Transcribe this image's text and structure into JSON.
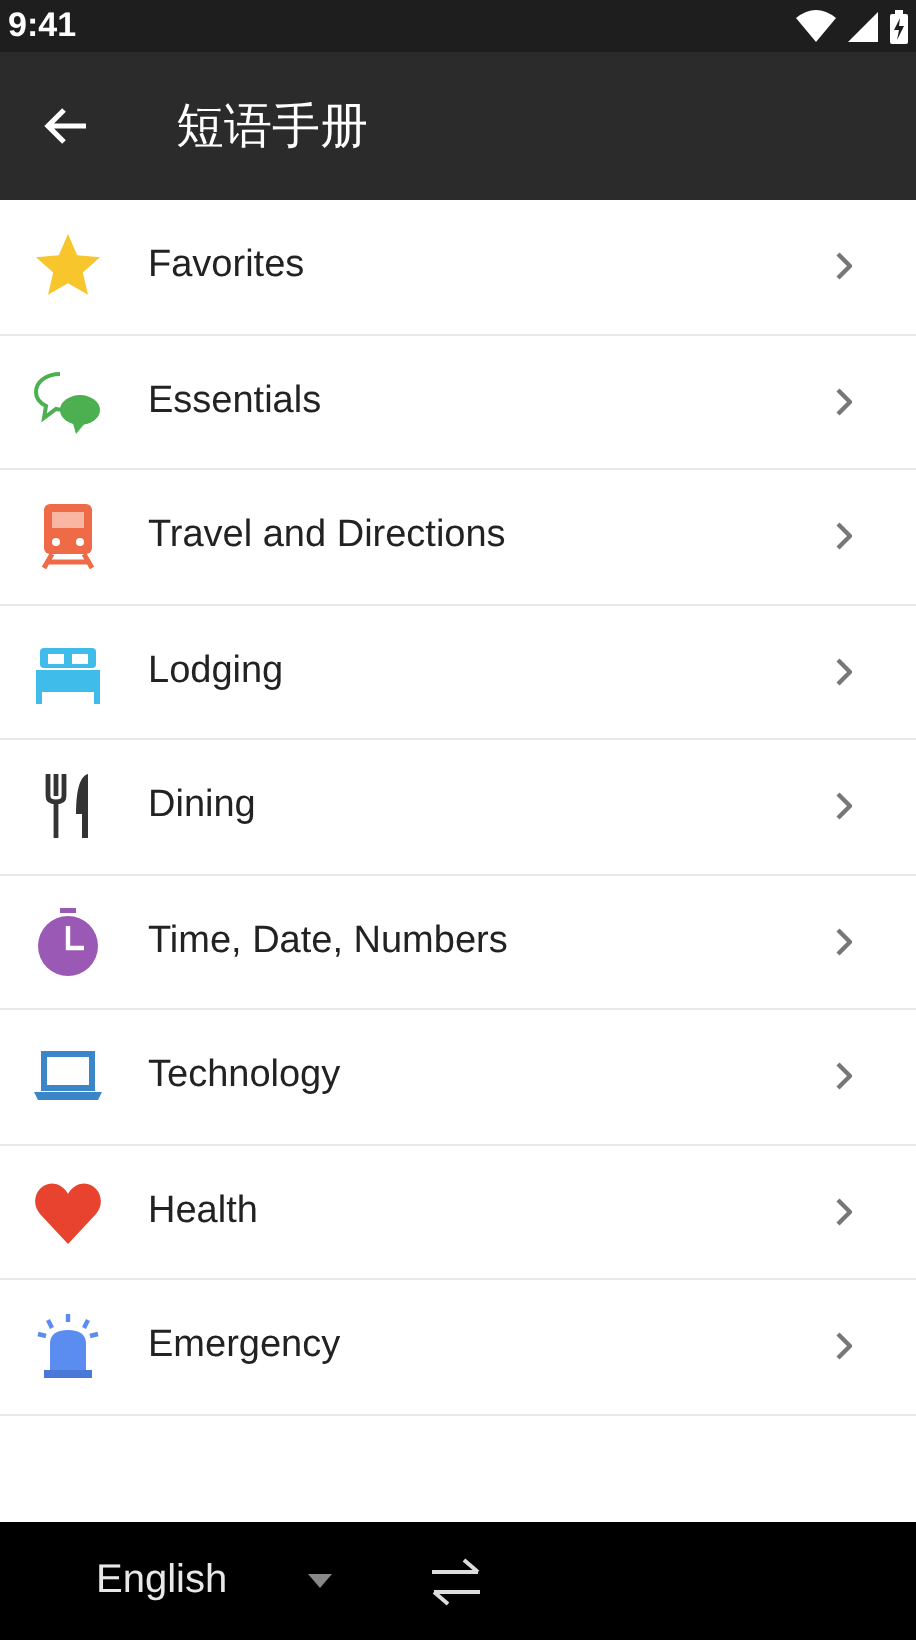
{
  "status_bar": {
    "time": "9:41"
  },
  "toolbar": {
    "title": "短语手册"
  },
  "categories": [
    {
      "label": "Favorites",
      "kind": "star"
    },
    {
      "label": "Essentials",
      "kind": "chat"
    },
    {
      "label": "Travel and Directions",
      "kind": "train"
    },
    {
      "label": "Lodging",
      "kind": "bed"
    },
    {
      "label": "Dining",
      "kind": "cutlery"
    },
    {
      "label": "Time, Date, Numbers",
      "kind": "timer"
    },
    {
      "label": "Technology",
      "kind": "laptop"
    },
    {
      "label": "Health",
      "kind": "heart"
    },
    {
      "label": "Emergency",
      "kind": "siren"
    }
  ],
  "language_bar": {
    "source_language": "English"
  }
}
